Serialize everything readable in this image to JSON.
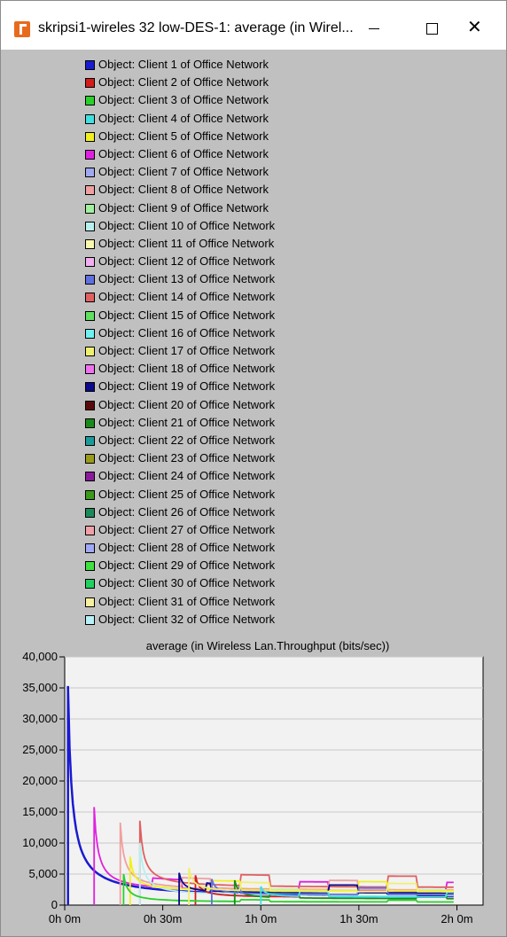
{
  "window": {
    "title": "skripsi1-wireles 32 low-DES-1: average (in Wirel...",
    "minimize_icon": "minimize-icon",
    "maximize_icon": "maximize-icon",
    "close_icon": "close-icon",
    "close_glyph": "✕"
  },
  "legend": [
    {
      "label": "Object: Client 1 of Office Network",
      "color": "#1a1ad0"
    },
    {
      "label": "Object: Client 2 of Office Network",
      "color": "#d41a1a"
    },
    {
      "label": "Object: Client 3 of Office Network",
      "color": "#2ad02a"
    },
    {
      "label": "Object: Client 4 of Office Network",
      "color": "#40e0e0"
    },
    {
      "label": "Object: Client 5 of Office Network",
      "color": "#f0f020"
    },
    {
      "label": "Object: Client 6 of Office Network",
      "color": "#e020e0"
    },
    {
      "label": "Object: Client 7 of Office Network",
      "color": "#a0a8f0"
    },
    {
      "label": "Object: Client 8 of Office Network",
      "color": "#f0a0a0"
    },
    {
      "label": "Object: Client 9 of Office Network",
      "color": "#a0f0a0"
    },
    {
      "label": "Object: Client 10 of Office Network",
      "color": "#b8f0f0"
    },
    {
      "label": "Object: Client 11 of Office Network",
      "color": "#f8f8b0"
    },
    {
      "label": "Object: Client 12 of Office Network",
      "color": "#f0b0f0"
    },
    {
      "label": "Object: Client 13 of Office Network",
      "color": "#6070e0"
    },
    {
      "label": "Object: Client 14 of Office Network",
      "color": "#e06060"
    },
    {
      "label": "Object: Client 15 of Office Network",
      "color": "#60e060"
    },
    {
      "label": "Object: Client 16 of Office Network",
      "color": "#70f0f0"
    },
    {
      "label": "Object: Client 17 of Office Network",
      "color": "#f0f070"
    },
    {
      "label": "Object: Client 18 of Office Network",
      "color": "#f070f0"
    },
    {
      "label": "Object: Client 19 of Office Network",
      "color": "#0a0a8a"
    },
    {
      "label": "Object: Client 20 of Office Network",
      "color": "#5a0a0a"
    },
    {
      "label": "Object: Client 21 of Office Network",
      "color": "#1a8a1a"
    },
    {
      "label": "Object: Client 22 of Office Network",
      "color": "#1a9a9a"
    },
    {
      "label": "Object: Client 23 of Office Network",
      "color": "#9a9a1a"
    },
    {
      "label": "Object: Client 24 of Office Network",
      "color": "#8a1a9a"
    },
    {
      "label": "Object: Client 25 of Office Network",
      "color": "#3a9a1a"
    },
    {
      "label": "Object: Client 26 of Office Network",
      "color": "#1a8a5a"
    },
    {
      "label": "Object: Client 27 of Office Network",
      "color": "#f0a0a8"
    },
    {
      "label": "Object: Client 28 of Office Network",
      "color": "#a0a8f8"
    },
    {
      "label": "Object: Client 29 of Office Network",
      "color": "#40e040"
    },
    {
      "label": "Object: Client 30 of Office Network",
      "color": "#20d060"
    },
    {
      "label": "Object: Client 31 of Office Network",
      "color": "#f8f0a0"
    },
    {
      "label": "Object: Client 32 of Office Network",
      "color": "#b8f0f8"
    }
  ],
  "chart_data": {
    "type": "line",
    "title": "average (in Wireless Lan.Throughput (bits/sec))",
    "xlabel": "",
    "ylabel": "",
    "ylim": [
      0,
      40000
    ],
    "xlim_minutes": [
      0,
      120
    ],
    "x_ticks": [
      "0h 0m",
      "0h 30m",
      "1h 0m",
      "1h 30m",
      "2h 0m"
    ],
    "x_tick_minutes": [
      0,
      30,
      60,
      90,
      120
    ],
    "y_ticks": [
      "0",
      "5,000",
      "10,000",
      "15,000",
      "20,000",
      "25,000",
      "30,000",
      "35,000",
      "40,000"
    ],
    "y_tick_values": [
      0,
      5000,
      10000,
      15000,
      20000,
      25000,
      30000,
      35000,
      40000
    ],
    "grid": true,
    "series": [
      {
        "name": "Object: Client 1 of Office Network",
        "color": "#1a1ad0",
        "start": 1,
        "peak": 35300,
        "end": 2000
      },
      {
        "name": "Object: Client 6 of Office Network",
        "color": "#e020e0",
        "start": 9,
        "peak": 15800,
        "end": 3900
      },
      {
        "name": "Object: Client 14 of Office Network",
        "color": "#e06060",
        "start": 23,
        "peak": 13600,
        "end": 5000
      },
      {
        "name": "Object: Client 8 of Office Network",
        "color": "#f0a0a0",
        "start": 17,
        "peak": 13300,
        "end": 4200
      },
      {
        "name": "Object: Client 10 of Office Network",
        "color": "#b8f0f0",
        "start": 23,
        "peak": 10000,
        "end": 2600
      },
      {
        "name": "Object: Client 5 of Office Network",
        "color": "#f0f020",
        "start": 20,
        "peak": 7800,
        "end": 4100
      },
      {
        "name": "Object: Client 2 of Office Network",
        "color": "#d41a1a",
        "start": 40,
        "peak": 4800,
        "end": 2200
      },
      {
        "name": "Object: Client 3 of Office Network",
        "color": "#2ad02a",
        "start": 18,
        "peak": 5000,
        "end": 800
      },
      {
        "name": "Object: Client 19 of Office Network",
        "color": "#0a0a8a",
        "start": 35,
        "peak": 5200,
        "end": 3500
      },
      {
        "name": "Object: Client 21 of Office Network",
        "color": "#1a8a1a",
        "start": 52,
        "peak": 4000,
        "end": 1800
      },
      {
        "name": "Object: Client 13 of Office Network",
        "color": "#6070e0",
        "start": 45,
        "peak": 4200,
        "end": 3000
      },
      {
        "name": "Object: Client 4 of Office Network",
        "color": "#40e0e0",
        "start": 60,
        "peak": 3000,
        "end": 2300
      },
      {
        "name": "Object: Client 17 of Office Network",
        "color": "#f0f070",
        "start": 38,
        "peak": 6000,
        "end": 3800
      }
    ]
  }
}
